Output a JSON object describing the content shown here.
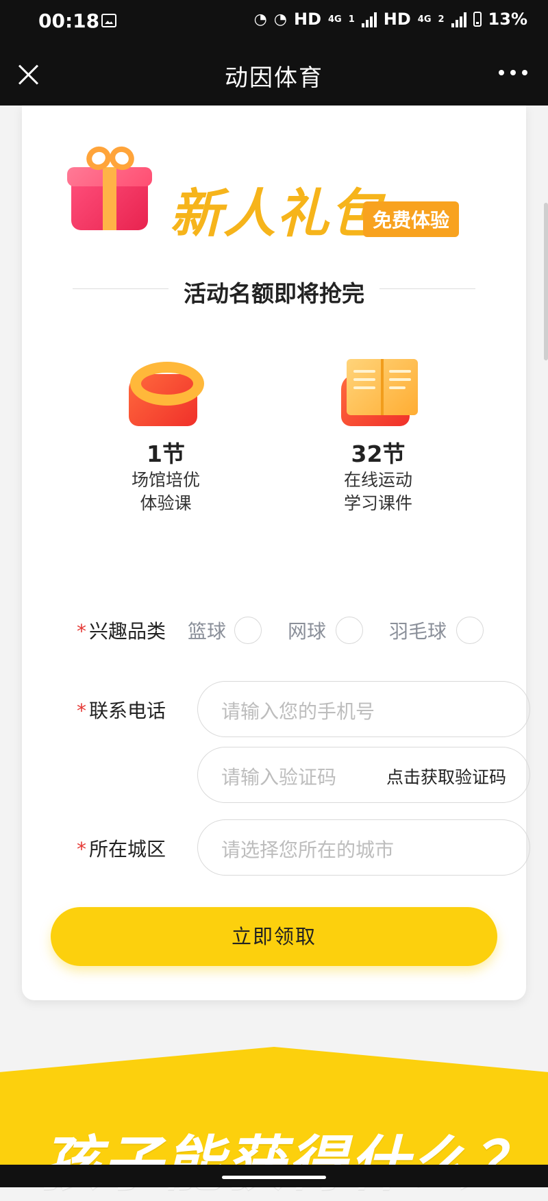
{
  "status_bar": {
    "time": "00:18",
    "network_labels": [
      "HD",
      "4G",
      "HD",
      "4G"
    ],
    "sim_badges": [
      "1",
      "2"
    ],
    "battery": "13%"
  },
  "nav": {
    "title": "动因体育",
    "close_icon": "close-icon",
    "more_icon": "more-icon"
  },
  "promo": {
    "title": "新人礼包",
    "badge": "免费体验",
    "notice": "活动名额即将抢完",
    "benefits": [
      {
        "icon": "ring-icon",
        "count": "1节",
        "line1": "场馆培优",
        "line2": "体验课"
      },
      {
        "icon": "book-icon",
        "count": "32节",
        "line1": "在线运动",
        "line2": "学习课件"
      }
    ]
  },
  "form": {
    "required_mark": "*",
    "interest_label": "兴趣品类",
    "interest_options": [
      "篮球",
      "网球",
      "羽毛球"
    ],
    "phone_label": "联系电话",
    "phone_placeholder": "请输入您的手机号",
    "code_placeholder": "请输入验证码",
    "get_code_label": "点击获取验证码",
    "city_label": "所在城区",
    "city_placeholder": "请选择您所在的城市",
    "submit_label": "立即领取"
  },
  "section": {
    "title": "孩子能获得什么？"
  },
  "colors": {
    "accent_yellow": "#fcd00d",
    "title_yellow": "#f6b41b",
    "badge_orange": "#f8a21f",
    "required_red": "#e53935"
  }
}
